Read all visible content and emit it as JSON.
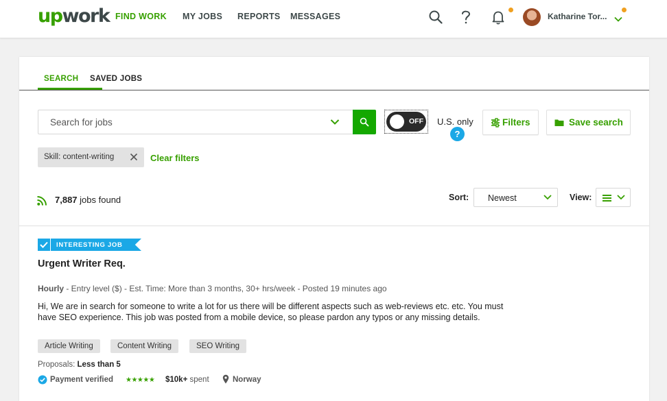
{
  "header": {
    "logo_up": "up",
    "logo_work": "work",
    "nav": [
      {
        "label": "FIND WORK",
        "active": true
      },
      {
        "label": "MY JOBS"
      },
      {
        "label": "REPORTS"
      },
      {
        "label": "MESSAGES"
      }
    ],
    "user_name": "Katharine Tor..."
  },
  "tabs": [
    "SEARCH",
    "SAVED JOBS"
  ],
  "search": {
    "placeholder": "Search for jobs",
    "toggle_label": "OFF",
    "us_only_label": "U.S. only",
    "help_glyph": "?",
    "filters_label": "Filters",
    "save_search_label": "Save search"
  },
  "filter_chip": "Skill: content-writing",
  "clear_filters_label": "Clear filters",
  "results": {
    "count": "7,887",
    "suffix": " jobs found",
    "sort_label": "Sort:",
    "sort_value": "Newest",
    "view_label": "View:"
  },
  "job": {
    "badge": "INTERESTING JOB",
    "title": "Urgent Writer Req.",
    "type": "Hourly",
    "meta": " - Entry level ($) - Est. Time: More than 3 months, 30+ hrs/week - Posted 19 minutes ago",
    "description": "Hi, We are in search for someone to write a lot for us there will be different aspects such as web-reviews etc. etc. You must have SEO experience. This job was posted from a mobile device, so please pardon any typos or any missing details.",
    "skills": [
      "Article Writing",
      "Content Writing",
      "SEO Writing"
    ],
    "proposals_label": "Proposals: ",
    "proposals_value": "Less than 5",
    "payment_verified": "Payment verified",
    "stars": "★★★★★",
    "spent_amount": "$10k+",
    "spent_suffix": " spent",
    "location": "Norway"
  },
  "colors": {
    "brand_green": "#37a000",
    "search_button": "#14a800",
    "badge_blue": "#1ba8e6",
    "notification_dot": "#f0a020"
  },
  "icons": [
    "search-icon",
    "help-icon",
    "bell-icon",
    "chevron-down-icon",
    "sliders-icon",
    "folder-icon",
    "close-icon",
    "rss-icon",
    "list-icon",
    "check-icon",
    "verified-icon",
    "map-pin-icon"
  ]
}
